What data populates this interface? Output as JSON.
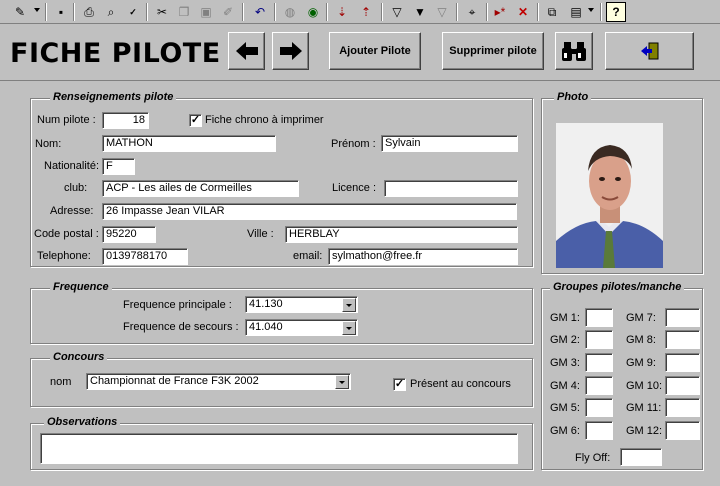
{
  "toolbar": {
    "icons": [
      "edit-mode-icon",
      "save-icon",
      "print-icon",
      "print-preview-icon",
      "spellcheck-icon",
      "cut-icon",
      "copy-icon",
      "paste-icon",
      "format-painter-icon",
      "undo-icon",
      "hyperlink-icon",
      "web-icon",
      "sort-ascending-icon",
      "sort-descending-icon",
      "filter-by-selection-icon",
      "filter-by-form-icon",
      "apply-filter-icon",
      "find-icon",
      "new-record-icon",
      "delete-record-icon",
      "database-window-icon",
      "new-object-icon",
      "help-icon"
    ]
  },
  "header": {
    "title": "FICHE PILOTE",
    "add_label": "Ajouter Pilote",
    "delete_label": "Supprimer pilote"
  },
  "renseignements": {
    "legend": "Renseignements pilote",
    "num_label": "Num pilote :",
    "num_value": "18",
    "chrono_label": "Fiche chrono à imprimer",
    "chrono_checked": "✓",
    "nom_label": "Nom:",
    "nom_value": "MATHON",
    "prenom_label": "Prénom :",
    "prenom_value": "Sylvain",
    "nationalite_label": "Nationalité:",
    "nationalite_value": "F",
    "club_label": "club:",
    "club_value": "ACP - Les ailes de Cormeilles",
    "licence_label": "Licence :",
    "licence_value": "",
    "adresse_label": "Adresse:",
    "adresse_value": "26 Impasse Jean VILAR",
    "cp_label": "Code postal :",
    "cp_value": "95220",
    "ville_label": "Ville :",
    "ville_value": "HERBLAY",
    "tel_label": "Telephone:",
    "tel_value": "0139788170",
    "email_label": "email:",
    "email_value": "sylmathon@free.fr"
  },
  "photo": {
    "legend": "Photo"
  },
  "frequence": {
    "legend": "Frequence",
    "principale_label": "Frequence principale :",
    "principale_value": "41.130",
    "secours_label": "Frequence de secours :",
    "secours_value": "41.040"
  },
  "concours": {
    "legend": "Concours",
    "nom_label": "nom",
    "nom_value": "Championnat de France F3K 2002",
    "present_label": "Présent au concours",
    "present_checked": "✓"
  },
  "observations": {
    "legend": "Observations",
    "value": ""
  },
  "groupes": {
    "legend": "Groupes pilotes/manche",
    "left": [
      "GM 1:",
      "GM 2:",
      "GM 3:",
      "GM 4:",
      "GM 5:",
      "GM 6:"
    ],
    "right": [
      "GM 7:",
      "GM 8:",
      "GM 9:",
      "GM 10:",
      "GM 11:",
      "GM 12:"
    ],
    "flyoff_label": "Fly Off:"
  }
}
